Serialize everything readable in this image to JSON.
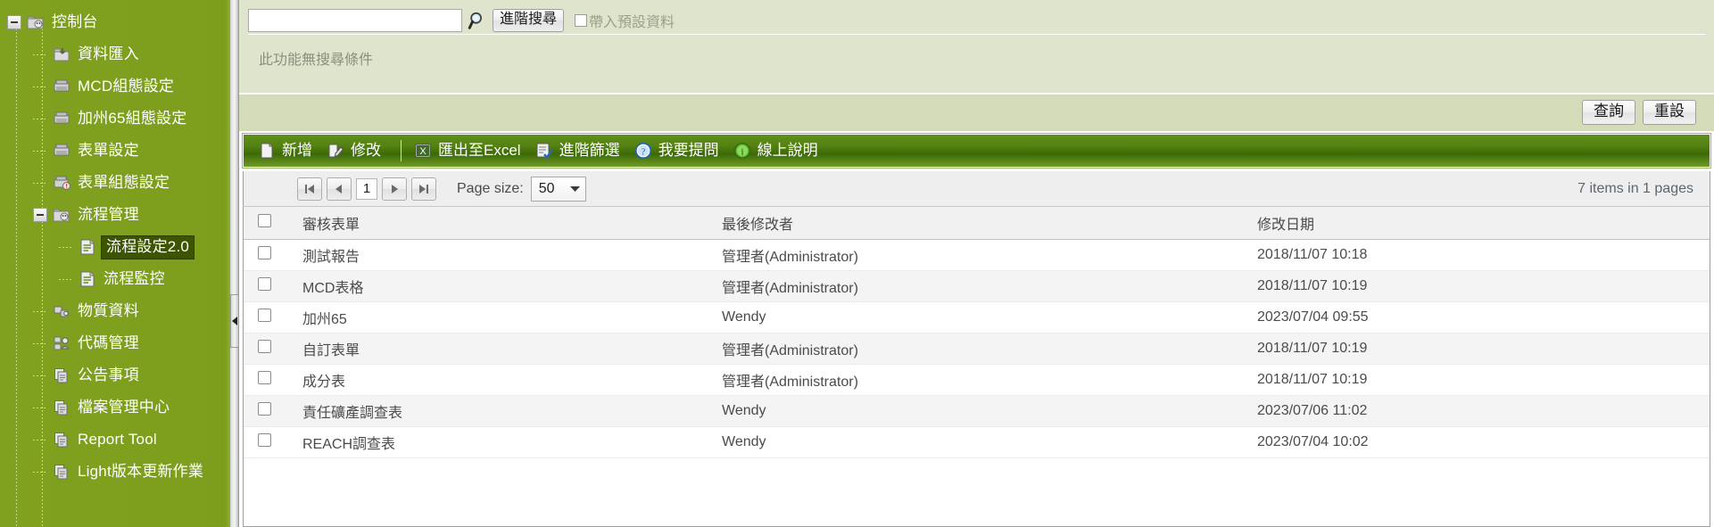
{
  "sidebar": {
    "items": [
      {
        "label": "控制台",
        "icon": "folder-open-icon",
        "level": 0,
        "expander": true,
        "selected": false
      },
      {
        "label": "資料匯入",
        "icon": "import-icon",
        "level": 1,
        "expander": false,
        "selected": false
      },
      {
        "label": "MCD組態設定",
        "icon": "config-icon",
        "level": 1,
        "expander": false,
        "selected": false
      },
      {
        "label": "加州65組態設定",
        "icon": "config-icon",
        "level": 1,
        "expander": false,
        "selected": false
      },
      {
        "label": "表單設定",
        "icon": "config-icon",
        "level": 1,
        "expander": false,
        "selected": false
      },
      {
        "label": "表單組態設定",
        "icon": "form-config-icon",
        "level": 1,
        "expander": false,
        "selected": false
      },
      {
        "label": "流程管理",
        "icon": "folder-open-icon",
        "level": 1,
        "expander": true,
        "selected": false
      },
      {
        "label": "流程設定2.0",
        "icon": "document-icon",
        "level": 2,
        "expander": false,
        "selected": true
      },
      {
        "label": "流程監控",
        "icon": "document-icon",
        "level": 2,
        "expander": false,
        "selected": false
      },
      {
        "label": "物質資料",
        "icon": "substance-icon",
        "level": 1,
        "expander": false,
        "selected": false
      },
      {
        "label": "代碼管理",
        "icon": "code-icon",
        "level": 1,
        "expander": false,
        "selected": false
      },
      {
        "label": "公告事項",
        "icon": "page-copy-icon",
        "level": 1,
        "expander": false,
        "selected": false
      },
      {
        "label": "檔案管理中心",
        "icon": "page-copy-icon",
        "level": 1,
        "expander": false,
        "selected": false
      },
      {
        "label": "Report Tool",
        "icon": "page-copy-icon",
        "level": 1,
        "expander": false,
        "selected": false
      },
      {
        "label": "Light版本更新作業",
        "icon": "page-copy-icon",
        "level": 1,
        "expander": false,
        "selected": false
      }
    ]
  },
  "search": {
    "input_value": "",
    "input_placeholder": "",
    "advanced_button": "進階搜尋",
    "checkbox_label": "帶入預設資料",
    "checkbox_checked": false,
    "condition_message": "此功能無搜尋條件",
    "query_button": "查詢",
    "reset_button": "重設"
  },
  "toolbar": {
    "items": [
      {
        "label": "新增",
        "icon": "new-document-icon"
      },
      {
        "label": "修改",
        "icon": "edit-icon"
      },
      {
        "label": "匯出至Excel",
        "icon": "excel-icon"
      },
      {
        "label": "進階篩選",
        "icon": "filter-icon"
      },
      {
        "label": "我要提問",
        "icon": "question-icon"
      },
      {
        "label": "線上說明",
        "icon": "info-icon"
      }
    ]
  },
  "pager": {
    "first_icon": "first-page-icon",
    "prev_icon": "prev-page-icon",
    "current_page": "1",
    "next_icon": "next-page-icon",
    "last_icon": "last-page-icon",
    "page_size_label": "Page size:",
    "page_size_value": "50",
    "dropdown_icon": "chevron-down-icon",
    "item_count": "7 items in 1 pages"
  },
  "grid": {
    "columns": [
      "審核表單",
      "最後修改者",
      "修改日期"
    ],
    "rows": [
      {
        "form": "測試報告",
        "modifier": "管理者(Administrator)",
        "date": "2018/11/07 10:18"
      },
      {
        "form": "MCD表格",
        "modifier": "管理者(Administrator)",
        "date": "2018/11/07 10:19"
      },
      {
        "form": "加州65",
        "modifier": "Wendy",
        "date": "2023/07/04 09:55"
      },
      {
        "form": "自訂表單",
        "modifier": "管理者(Administrator)",
        "date": "2018/11/07 10:19"
      },
      {
        "form": "成分表",
        "modifier": "管理者(Administrator)",
        "date": "2018/11/07 10:19"
      },
      {
        "form": "責任礦產調查表",
        "modifier": "Wendy",
        "date": "2023/07/06 11:02"
      },
      {
        "form": "REACH調查表",
        "modifier": "Wendy",
        "date": "2023/07/04 10:02"
      }
    ]
  },
  "colors": {
    "sidebar_green": "#7fa01e",
    "toolbar_green": "#4e7e10",
    "selected_item": "#3d5400",
    "search_panel": "#dfe5cd"
  }
}
